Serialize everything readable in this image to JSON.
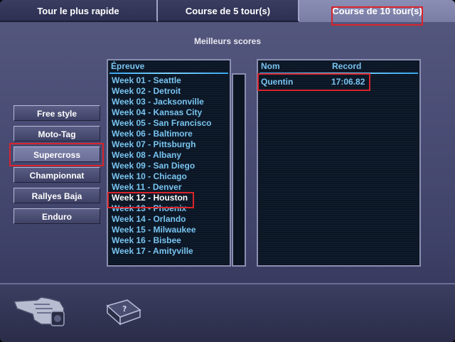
{
  "tabs": [
    {
      "label": "Tour le plus rapide"
    },
    {
      "label": "Course de 5 tour(s)"
    },
    {
      "label": "Course de 10 tour(s)"
    }
  ],
  "section_title": "Meilleurs scores",
  "menu": [
    {
      "label": "Free style"
    },
    {
      "label": "Moto-Tag"
    },
    {
      "label": "Supercross"
    },
    {
      "label": "Championnat"
    },
    {
      "label": "Rallyes Baja"
    },
    {
      "label": "Enduro"
    }
  ],
  "events_panel": {
    "header": "Épreuve",
    "items": [
      "Week 01 - Seattle",
      "Week 02 - Detroit",
      "Week 03 - Jacksonville",
      "Week 04 - Kansas City",
      "Week 05 - San Francisco",
      "Week 06 - Baltimore",
      "Week 07 - Pittsburgh",
      "Week 08 - Albany",
      "Week 09 - San Diego",
      "Week 10 - Chicago",
      "Week 11 - Denver",
      "Week 12 - Houston",
      "Week 13 - Phoenix",
      "Week 14 - Orlando",
      "Week 15 - Milwaukee",
      "Week 16 - Bisbee",
      "Week 17 - Amityville"
    ]
  },
  "scores_panel": {
    "col_name": "Nom",
    "col_record": "Record",
    "rows": [
      {
        "name": "Quentin",
        "record": "17:06.82"
      }
    ]
  },
  "icons": {
    "back": "pointing-hand-icon",
    "help": "help-book-icon"
  },
  "colors": {
    "list_text": "#78c4f0",
    "selected_text": "#ffffff",
    "highlight": "#d8242c"
  }
}
